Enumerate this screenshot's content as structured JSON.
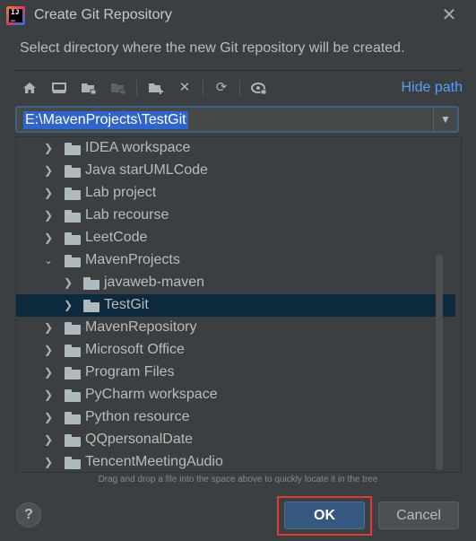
{
  "window": {
    "title": "Create Git Repository",
    "description": "Select directory where the new Git repository will be created."
  },
  "toolbar": {
    "icons": [
      "home-icon",
      "desktop-icon",
      "project-folder-icon",
      "module-folder-icon",
      "new-folder-icon",
      "delete-icon",
      "refresh-icon",
      "show-hidden-icon"
    ],
    "hide_path": "Hide path"
  },
  "path": {
    "value": "E:\\MavenProjects\\TestGit"
  },
  "tree": {
    "items": [
      {
        "label": "IDEA workspace",
        "expanded": false
      },
      {
        "label": "Java starUMLCode",
        "expanded": false
      },
      {
        "label": "Lab project",
        "expanded": false
      },
      {
        "label": "Lab recourse",
        "expanded": false
      },
      {
        "label": "LeetCode",
        "expanded": false
      },
      {
        "label": "MavenProjects",
        "expanded": true
      },
      {
        "label": "javaweb-maven",
        "expanded": false
      },
      {
        "label": "TestGit",
        "expanded": false,
        "selected": true
      },
      {
        "label": "MavenRepository",
        "expanded": false
      },
      {
        "label": "Microsoft Office",
        "expanded": false
      },
      {
        "label": "Program Files",
        "expanded": false
      },
      {
        "label": "PyCharm workspace",
        "expanded": false
      },
      {
        "label": "Python resource",
        "expanded": false
      },
      {
        "label": "QQpersonalDate",
        "expanded": false
      },
      {
        "label": "TencentMeetingAudio",
        "expanded": false
      }
    ]
  },
  "hint": "Drag and drop a file into the space above to quickly locate it in the tree",
  "buttons": {
    "help": "?",
    "ok": "OK",
    "cancel": "Cancel"
  }
}
